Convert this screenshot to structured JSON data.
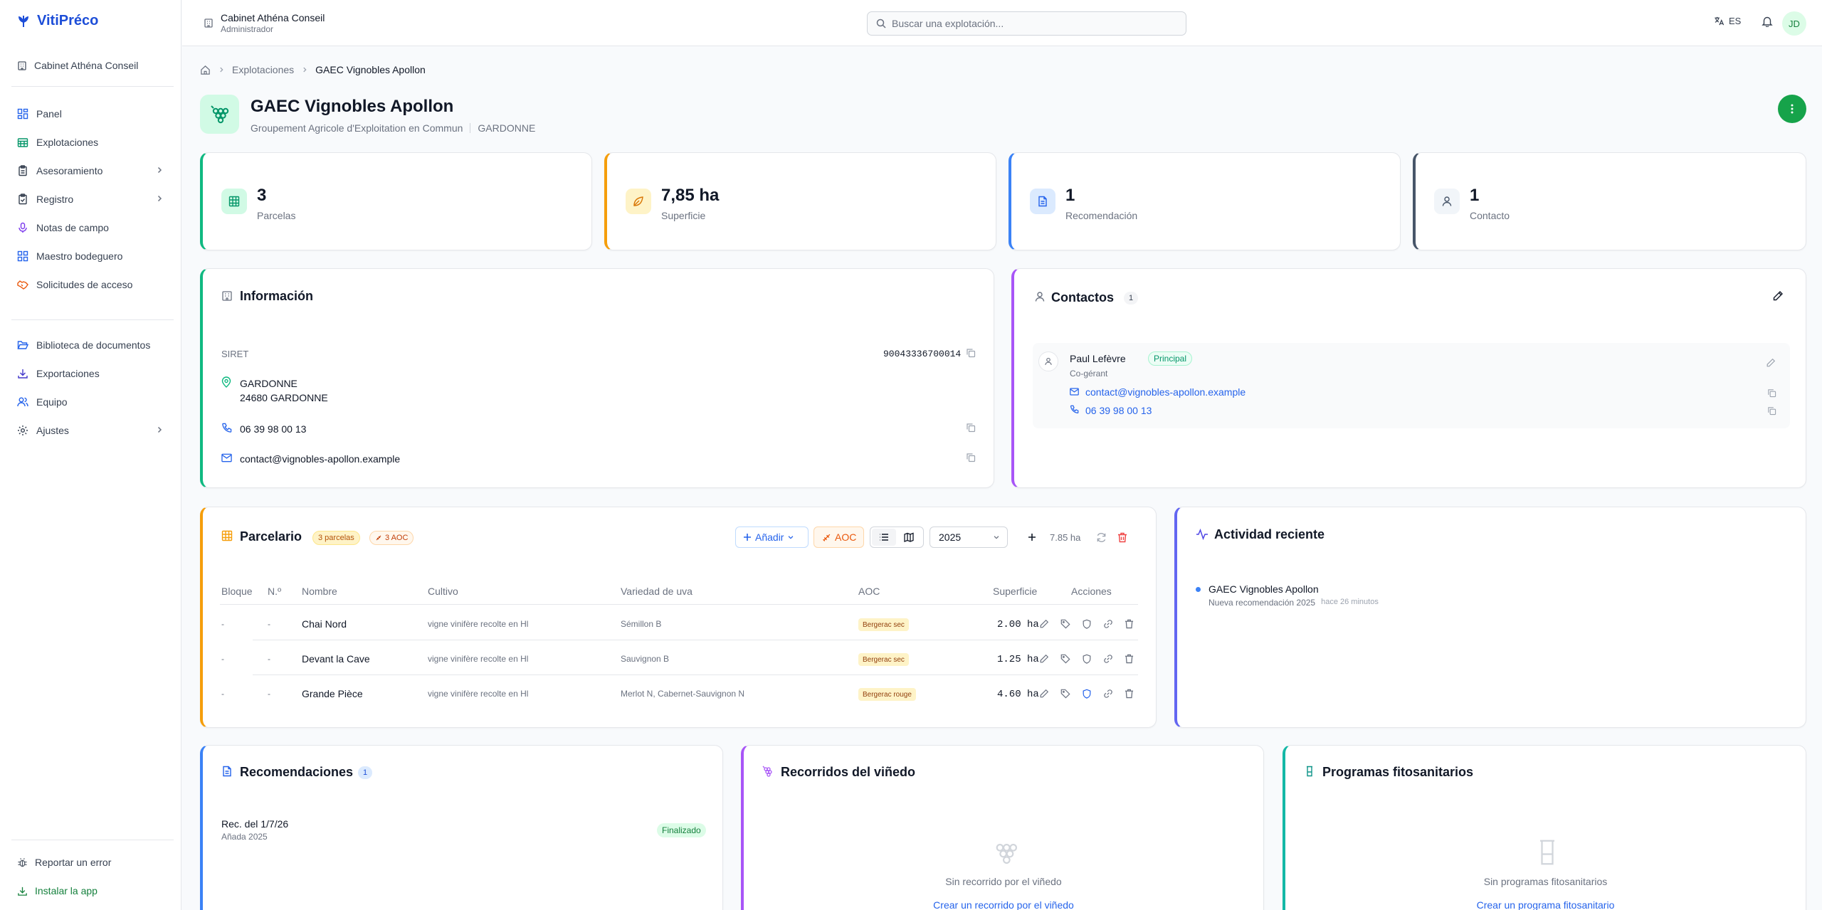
{
  "app": {
    "name": "VitiPréco"
  },
  "sidebar": {
    "cabinet": "Cabinet Athéna Conseil",
    "items": [
      {
        "label": "Panel",
        "icon": "dashboard-icon"
      },
      {
        "label": "Explotaciones",
        "icon": "building-icon"
      },
      {
        "label": "Asesoramiento",
        "icon": "clipboard-icon"
      },
      {
        "label": "Registro",
        "icon": "clipboard-check-icon"
      },
      {
        "label": "Notas de campo",
        "icon": "microphone-icon"
      },
      {
        "label": "Maestro bodeguero",
        "icon": "grid-icon"
      },
      {
        "label": "Solicitudes de acceso",
        "icon": "handshake-icon"
      }
    ],
    "items2": [
      {
        "label": "Biblioteca de documentos",
        "icon": "folder-open-icon"
      },
      {
        "label": "Exportaciones",
        "icon": "download-icon"
      },
      {
        "label": "Equipo",
        "icon": "users-icon"
      },
      {
        "label": "Ajustes",
        "icon": "gear-icon"
      }
    ],
    "report_bug": "Reportar un error",
    "install_app": "Instalar la app"
  },
  "topbar": {
    "org_name": "Cabinet Athéna Conseil",
    "org_role": "Administrador",
    "search_placeholder": "Buscar una explotación...",
    "lang": "ES",
    "avatar": "JD"
  },
  "breadcrumb": {
    "level1": "Explotaciones",
    "current": "GAEC Vignobles Apollon"
  },
  "header": {
    "title": "GAEC Vignobles Apollon",
    "subtitle": "Groupement Agricole d'Exploitation en Commun",
    "commune": "GARDONNE"
  },
  "stats": [
    {
      "value": "3",
      "label": "Parcelas",
      "color": "#10b981"
    },
    {
      "value": "7,85 ha",
      "label": "Superficie",
      "color": "#f59e0b"
    },
    {
      "value": "1",
      "label": "Recomendación",
      "color": "#3b82f6"
    },
    {
      "value": "1",
      "label": "Contacto",
      "color": "#475569"
    }
  ],
  "info": {
    "title": "Información",
    "siret_label": "SIRET",
    "siret": "90043336700014",
    "address_line1": "GARDONNE",
    "address_line2": "24680 GARDONNE",
    "phone": "06 39 98 00 13",
    "email": "contact@vignobles-apollon.example"
  },
  "contacts": {
    "title": "Contactos",
    "count": "1",
    "list": [
      {
        "name": "Paul Lefèvre",
        "badge": "Principal",
        "role": "Co-gérant",
        "email": "contact@vignobles-apollon.example",
        "phone": "06 39 98 00 13"
      }
    ]
  },
  "parcelario": {
    "title": "Parcelario",
    "badge_parcels": "3 parcelas",
    "badge_aoc": "3 AOC",
    "add_label": "Añadir",
    "aoc_button": "AOC",
    "year": "2025",
    "total": "7.85 ha",
    "columns": [
      "Bloque",
      "N.º",
      "Nombre",
      "Cultivo",
      "Variedad de uva",
      "AOC",
      "Superficie",
      "Acciones"
    ],
    "rows": [
      {
        "bloque": "-",
        "num": "-",
        "nombre": "Chai Nord",
        "cultivo": "vigne vinifère recolte en Hl",
        "variedad": "Sémillon B",
        "aoc": "Bergerac sec",
        "superficie": "2.00 ha"
      },
      {
        "bloque": "-",
        "num": "-",
        "nombre": "Devant la Cave",
        "cultivo": "vigne vinifère recolte en Hl",
        "variedad": "Sauvignon B",
        "aoc": "Bergerac sec",
        "superficie": "1.25 ha"
      },
      {
        "bloque": "-",
        "num": "-",
        "nombre": "Grande Pièce",
        "cultivo": "vigne vinifère recolte en Hl",
        "variedad": "Merlot N, Cabernet-Sauvignon N",
        "aoc": "Bergerac rouge",
        "superficie": "4.60 ha"
      }
    ]
  },
  "activity": {
    "title": "Actividad reciente",
    "items": [
      {
        "title": "GAEC Vignobles Apollon",
        "desc": "Nueva recomendación 2025",
        "time": "hace 26 minutos"
      }
    ]
  },
  "recommendations": {
    "title": "Recomendaciones",
    "count": "1",
    "items": [
      {
        "title": "Rec. del 1/7/26",
        "sub": "Añada 2025",
        "status": "Finalizado"
      }
    ]
  },
  "recorridos": {
    "title": "Recorridos del viñedo",
    "empty": "Sin recorrido por el viñedo",
    "cta": "Crear un recorrido por el viñedo"
  },
  "programas": {
    "title": "Programas fitosanitarios",
    "empty": "Sin programas fitosanitarios",
    "cta": "Crear un programa fitosanitario"
  }
}
